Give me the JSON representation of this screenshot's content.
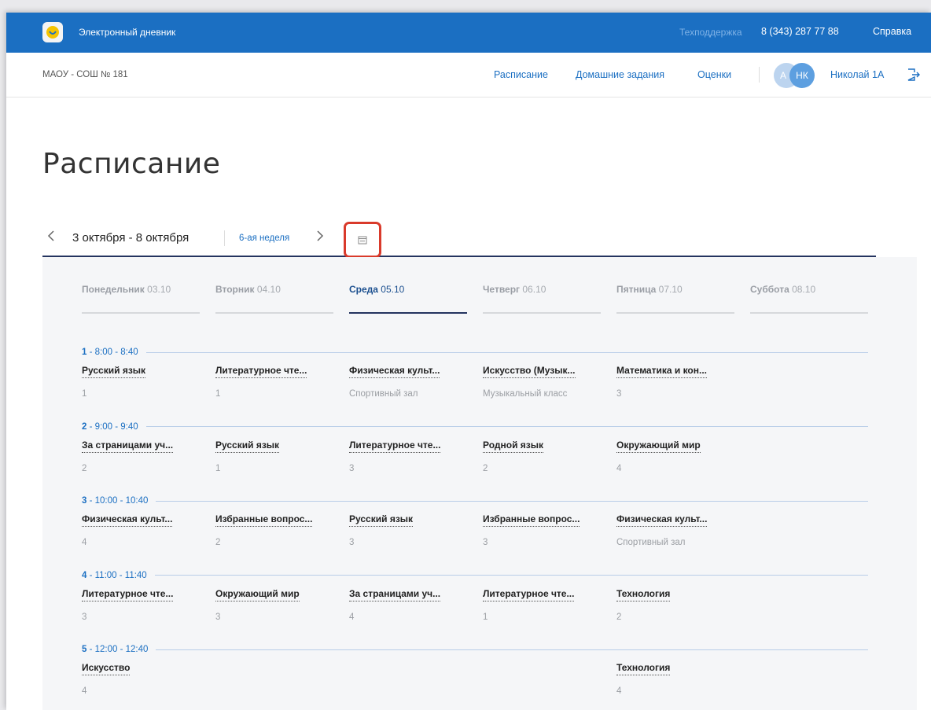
{
  "topbar": {
    "app_title": "Электронный дневник",
    "support_label": "Техподдержка",
    "support_phone": "8 (343) 287 77 88",
    "help_label": "Справка",
    "accent_color": "#1b6fc2"
  },
  "header": {
    "school": "МАОУ - СОШ № 181",
    "nav": [
      "Расписание",
      "Домашние задания",
      "Оценки"
    ],
    "avatar_a": "А",
    "avatar_initials": "НК",
    "user_name": "Николай 1А",
    "logout_icon": "logout-icon"
  },
  "page": {
    "title": "Расписание"
  },
  "week": {
    "range": "3 октября - 8 октября",
    "number": "6-ая неделя",
    "prev_icon": "chevron-left-icon",
    "next_icon": "chevron-right-icon",
    "calendar_icon": "calendar-icon",
    "highlight_color": "#d93a2b"
  },
  "schedule": {
    "days": [
      {
        "name": "Понедельник",
        "date": "03.10",
        "active": false
      },
      {
        "name": "Вторник",
        "date": "04.10",
        "active": false
      },
      {
        "name": "Среда",
        "date": "05.10",
        "active": true
      },
      {
        "name": "Четверг",
        "date": "06.10",
        "active": false
      },
      {
        "name": "Пятница",
        "date": "07.10",
        "active": false
      },
      {
        "name": "Суббота",
        "date": "08.10",
        "active": false
      }
    ],
    "slots": [
      {
        "num": "1",
        "time": " - 8:00 - 8:40",
        "lessons": [
          {
            "subject": "Русский язык",
            "room": "1"
          },
          {
            "subject": "Литературное чте...",
            "room": "1"
          },
          {
            "subject": "Физическая культ...",
            "room": "Спортивный зал"
          },
          {
            "subject": "Искусство (Музык...",
            "room": "Музыкальный класс"
          },
          {
            "subject": "Математика и кон...",
            "room": "3"
          },
          null
        ]
      },
      {
        "num": "2",
        "time": " - 9:00 - 9:40",
        "lessons": [
          {
            "subject": "За страницами уч...",
            "room": "2"
          },
          {
            "subject": "Русский язык",
            "room": "1"
          },
          {
            "subject": "Литературное чте...",
            "room": "3"
          },
          {
            "subject": "Родной язык",
            "room": "2"
          },
          {
            "subject": "Окружающий мир",
            "room": "4"
          },
          null
        ]
      },
      {
        "num": "3",
        "time": " - 10:00 - 10:40",
        "lessons": [
          {
            "subject": "Физическая культ...",
            "room": "4"
          },
          {
            "subject": "Избранные вопрос...",
            "room": "2"
          },
          {
            "subject": "Русский язык",
            "room": "3"
          },
          {
            "subject": "Избранные вопрос...",
            "room": "3"
          },
          {
            "subject": "Физическая культ...",
            "room": "Спортивный зал"
          },
          null
        ]
      },
      {
        "num": "4",
        "time": " - 11:00 - 11:40",
        "lessons": [
          {
            "subject": "Литературное чте...",
            "room": "3"
          },
          {
            "subject": "Окружающий мир",
            "room": "3"
          },
          {
            "subject": "За страницами уч...",
            "room": "4"
          },
          {
            "subject": "Литературное чте...",
            "room": "1"
          },
          {
            "subject": "Технология",
            "room": "2"
          },
          null
        ]
      },
      {
        "num": "5",
        "time": " - 12:00 - 12:40",
        "lessons": [
          {
            "subject": "Искусство",
            "room": "4"
          },
          null,
          null,
          null,
          {
            "subject": "Технология",
            "room": "4"
          },
          null
        ]
      }
    ]
  }
}
